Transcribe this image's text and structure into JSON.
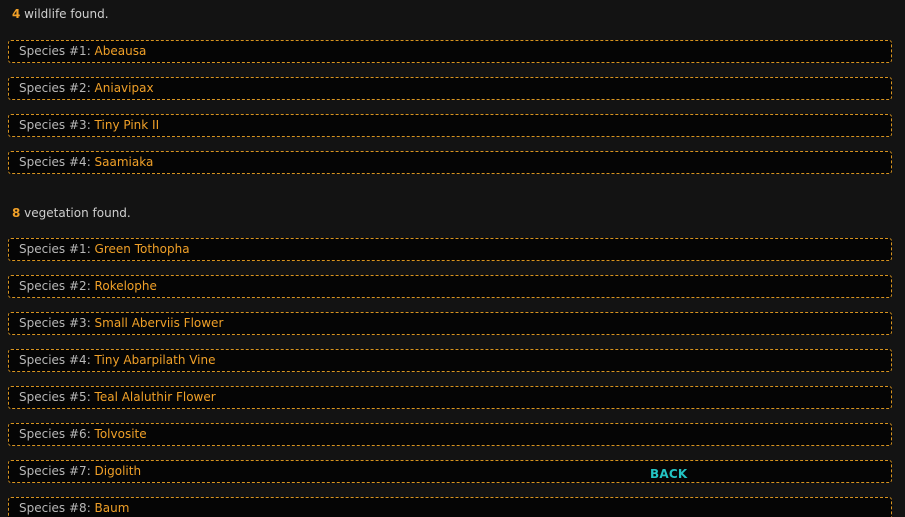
{
  "wildlife": {
    "count": "4",
    "suffix": " wildlife found.",
    "items": [
      {
        "prefix": "Species #1: ",
        "name": "Abeausa"
      },
      {
        "prefix": "Species #2: ",
        "name": "Aniavipax"
      },
      {
        "prefix": "Species #3: ",
        "name": "Tiny Pink II"
      },
      {
        "prefix": "Species #4: ",
        "name": "Saamiaka"
      }
    ]
  },
  "vegetation": {
    "count": "8",
    "suffix": " vegetation found.",
    "items": [
      {
        "prefix": "Species #1: ",
        "name": "Green Tothopha"
      },
      {
        "prefix": "Species #2: ",
        "name": "Rokelophe"
      },
      {
        "prefix": "Species #3: ",
        "name": "Small Aberviis Flower"
      },
      {
        "prefix": "Species #4: ",
        "name": "Tiny Abarpilath Vine"
      },
      {
        "prefix": "Species #5: ",
        "name": "Teal Alaluthir Flower"
      },
      {
        "prefix": "Species #6: ",
        "name": "Tolvosite"
      },
      {
        "prefix": "Species #7: ",
        "name": "Digolith"
      },
      {
        "prefix": "Species #8: ",
        "name": "Baum"
      }
    ]
  },
  "back_label": "BACK",
  "colors": {
    "accent": "#f0a028",
    "back": "#23c3c3",
    "background": "#131313"
  }
}
